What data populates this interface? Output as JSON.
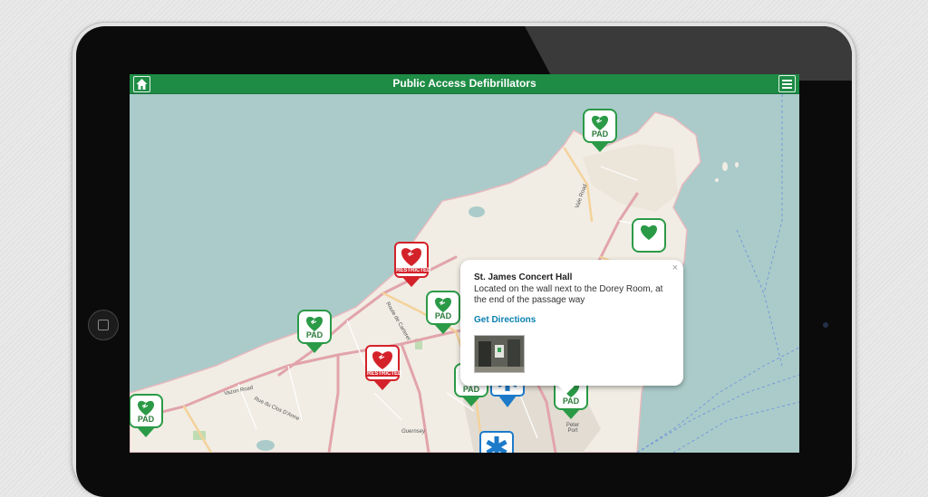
{
  "app": {
    "title": "Public Access Defibrillators"
  },
  "map": {
    "place_labels": [
      "Peter Port",
      "Guernsey"
    ],
    "road_labels": [
      "Vazon Road",
      "Rue du Clos D'Anne",
      "Route de Carteret",
      "Vale Road"
    ]
  },
  "markers": [
    {
      "kind": "pad",
      "label": "PAD"
    },
    {
      "kind": "restricted",
      "label": "RESTRICTED"
    },
    {
      "kind": "restricted",
      "label": "RESTRICTED"
    },
    {
      "kind": "ambulance",
      "label": ""
    }
  ],
  "popup": {
    "title": "St. James Concert Hall",
    "description": "Located on the wall next to the Dorey Room, at the end of the passage way",
    "link": "Get Directions",
    "close": "×"
  },
  "colors": {
    "header": "#1e8c45",
    "pad_green": "#2b9a47",
    "restricted_red": "#d4222a",
    "ambulance_blue": "#1c7ac9",
    "sea": "#aacbc9",
    "land": "#f1ede4"
  }
}
